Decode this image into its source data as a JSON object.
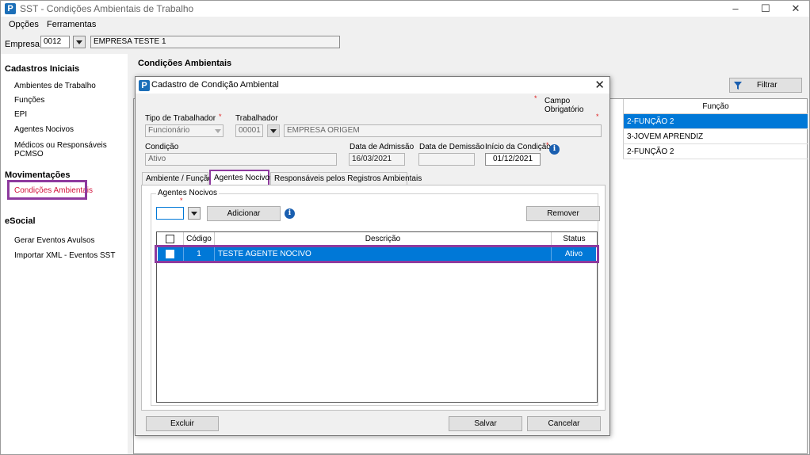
{
  "window": {
    "title": "SST - Condições Ambientais de Trabalho"
  },
  "menu": [
    "Opções",
    "Ferramentas"
  ],
  "empresa": {
    "label": "Empresa:",
    "code": "0012",
    "name": "EMPRESA TESTE 1"
  },
  "sidebar": {
    "sections": [
      {
        "title": "Cadastros Iniciais",
        "items": [
          "Ambientes de Trabalho",
          "Funções",
          "EPI",
          "Agentes Nocivos",
          "Médicos ou Responsáveis PCMSO"
        ]
      },
      {
        "title": "Movimentações",
        "items": [
          "Condições Ambientais"
        ]
      },
      {
        "title": "eSocial",
        "items": [
          "Gerar Eventos Avulsos",
          "Importar XML - Eventos SST"
        ]
      }
    ]
  },
  "main": {
    "title": "Condições Ambientais",
    "filter_label": "Filtrar",
    "column_header": "Função",
    "rows": [
      "2-FUNÇÃO 2",
      "3-JOVEM APRENDIZ",
      "2-FUNÇÃO 2"
    ]
  },
  "dialog": {
    "title": "Cadastro de Condição Ambiental",
    "required_note": "Campo Obrigatório",
    "required_mark": "*",
    "tipo_label": "Tipo de Trabalhador",
    "tipo_value": "Funcionário",
    "trabalhador_label": "Trabalhador",
    "trabalhador_code": "00001",
    "trabalhador_name": "EMPRESA ORIGEM",
    "condicao_label": "Condição",
    "condicao_value": "Ativo",
    "admissao_label": "Data de Admissão",
    "admissao_value": "16/03/2021",
    "demissao_label": "Data de Demissão",
    "demissao_value": "",
    "inicio_label": "Início da Condição",
    "inicio_value": "01/12/2021",
    "tabs": [
      "Ambiente / Função",
      "Agentes Nocivos",
      "Responsáveis pelos Registros Ambientais"
    ],
    "group_title": "Agentes Nocivos",
    "add_label": "Adicionar",
    "remove_label": "Remover",
    "grid_headers": [
      "Código",
      "Descrição",
      "Status"
    ],
    "grid_rows": [
      {
        "code": "1",
        "desc": "TESTE AGENTE NOCIVO",
        "status": "Ativo"
      }
    ],
    "excluir_label": "Excluir",
    "salvar_label": "Salvar",
    "cancelar_label": "Cancelar"
  },
  "colors": {
    "accent": "#0078d7",
    "highlight": "#8e3a9e",
    "required": "#e02020"
  }
}
